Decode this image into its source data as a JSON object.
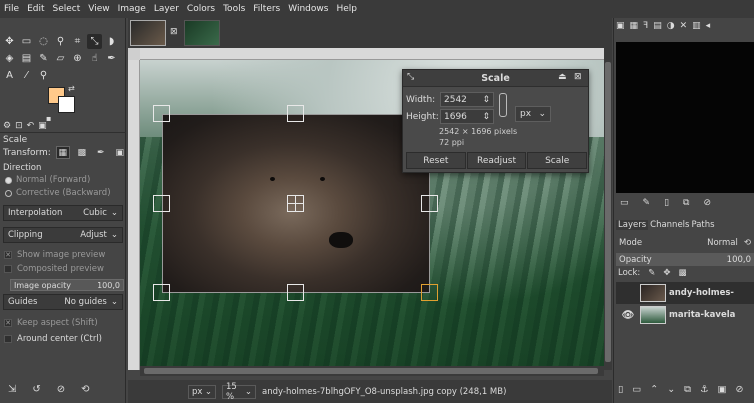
{
  "menu": [
    "File",
    "Edit",
    "Select",
    "View",
    "Image",
    "Layer",
    "Colors",
    "Tools",
    "Filters",
    "Windows",
    "Help"
  ],
  "colors": {
    "foreground": "#ffc98a",
    "background": "#ffffff"
  },
  "tools": [
    "move-icon",
    "rect-select-icon",
    "lasso-icon",
    "fuzzy-select-icon",
    "crop-icon",
    "unified-transform-icon",
    "warp-icon",
    "bucket-icon",
    "gradient-icon",
    "paintbrush-icon",
    "eraser-icon",
    "clone-icon",
    "smudge-icon",
    "path-icon",
    "text-icon",
    "color-picker-icon",
    "zoom-icon"
  ],
  "tool_options": {
    "title": "Scale",
    "transform_label": "Transform:",
    "direction_label": "Direction",
    "direction_normal": "Normal (Forward)",
    "direction_corrective": "Corrective (Backward)",
    "interpolation_label": "Interpolation",
    "interpolation_value": "Cubic",
    "clipping_label": "Clipping",
    "clipping_value": "Adjust",
    "show_preview": "Show image preview",
    "composited_preview": "Composited preview",
    "opacity_label": "Image opacity",
    "opacity_value": "100,0",
    "opacity_fraction": 1.0,
    "guides_label": "Guides",
    "guides_value": "No guides",
    "keep_aspect": "Keep aspect (Shift)",
    "around_center": "Around center (Ctrl)"
  },
  "scale_dialog": {
    "title": "Scale",
    "width_label": "Width:",
    "width_value": "2542",
    "height_label": "Height:",
    "height_value": "1696",
    "unit": "px",
    "pixels_info": "2542 × 1696 pixels",
    "ppi_info": "72 ppi",
    "reset": "Reset",
    "readjust": "Readjust",
    "scale": "Scale"
  },
  "status": {
    "unit": "px",
    "zoom": "15 %",
    "filename": "andy-holmes-7blhgOFY_O8-unsplash.jpg copy (248,1 MB)"
  },
  "layers_panel": {
    "tabs": [
      "Layers",
      "Channels",
      "Paths"
    ],
    "mode_label": "Mode",
    "mode_value": "Normal",
    "opacity_label": "Opacity",
    "opacity_value": "100,0",
    "opacity_fraction": 1.0,
    "lock_label": "Lock:",
    "layers": [
      {
        "name": "andy-holmes-",
        "visible": false
      },
      {
        "name": "marita-kavela",
        "visible": true
      }
    ]
  }
}
